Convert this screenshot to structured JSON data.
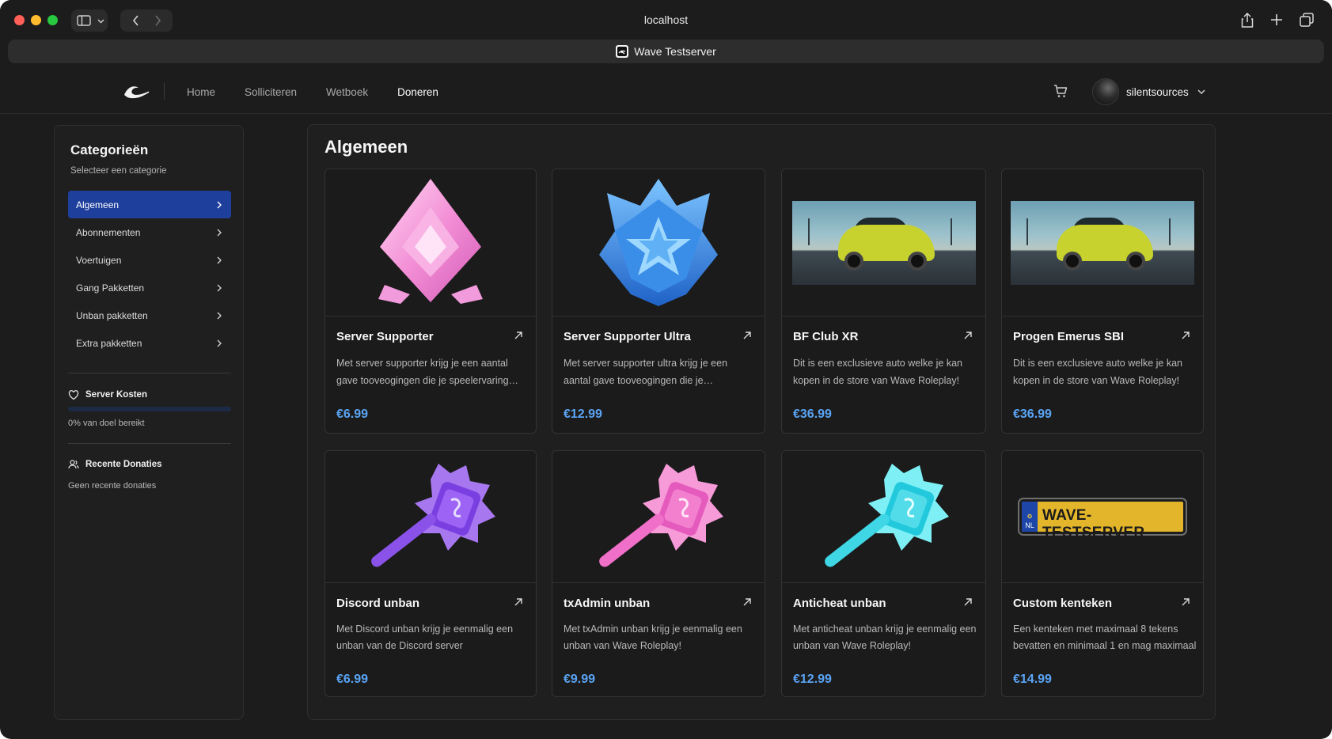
{
  "browser": {
    "url": "localhost",
    "tab_title": "Wave Testserver"
  },
  "nav": {
    "items": [
      {
        "label": "Home",
        "active": false
      },
      {
        "label": "Solliciteren",
        "active": false
      },
      {
        "label": "Wetboek",
        "active": false
      },
      {
        "label": "Doneren",
        "active": true
      }
    ],
    "username": "silentsources"
  },
  "sidebar": {
    "title": "Categorieën",
    "subtitle": "Selecteer een categorie",
    "categories": [
      {
        "label": "Algemeen",
        "active": true
      },
      {
        "label": "Abonnementen",
        "active": false
      },
      {
        "label": "Voertuigen",
        "active": false
      },
      {
        "label": "Gang Pakketten",
        "active": false
      },
      {
        "label": "Unban pakketten",
        "active": false
      },
      {
        "label": "Extra pakketten",
        "active": false
      }
    ],
    "server_kosten": {
      "title": "Server Kosten",
      "progress_percent": 0,
      "progress_text": "0% van doel bereikt"
    },
    "recent": {
      "title": "Recente Donaties",
      "empty_text": "Geen recente donaties"
    }
  },
  "main": {
    "title": "Algemeen",
    "products": [
      {
        "name": "Server Supporter",
        "description": "Met server supporter krijg je een aantal gave tooveogingen die je speelervaring verbeteren",
        "price": "€6.99",
        "image": "pink-diamond-badge"
      },
      {
        "name": "Server Supporter Ultra",
        "description": "Met server supporter ultra krijg je een aantal gave tooveogingen die je speelervaring verbeteren",
        "price": "€12.99",
        "image": "blue-star-crest"
      },
      {
        "name": "BF Club XR",
        "description": "Dit is een exclusieve auto welke je kan kopen in de store van Wave Roleplay!",
        "price": "€36.99",
        "image": "yellow-car-photo"
      },
      {
        "name": "Progen Emerus SBI",
        "description": "Dit is een exclusieve auto welke je kan kopen in de store van Wave Roleplay!",
        "price": "€36.99",
        "image": "yellow-car-photo"
      },
      {
        "name": "Discord unban",
        "description": "Met Discord unban krijg je eenmalig een unban van de Discord server",
        "price": "€6.99",
        "image": "purple-hammer"
      },
      {
        "name": "txAdmin unban",
        "description": "Met txAdmin unban krijg je eenmalig een unban van Wave Roleplay!",
        "price": "€9.99",
        "image": "pink-hammer"
      },
      {
        "name": "Anticheat unban",
        "description": "Met anticheat unban krijg je eenmalig een unban van Wave Roleplay!",
        "price": "€12.99",
        "image": "cyan-hammer"
      },
      {
        "name": "Custom kenteken",
        "description": "Een kenteken met maximaal 8 tekens bevatten en minimaal 1 en mag maximaal",
        "price": "€14.99",
        "image": "license-plate",
        "plate_country": "NL",
        "plate_text": "WAVE-TESTSERVER"
      }
    ]
  },
  "colors": {
    "accent": "#1f3f9d",
    "price": "#5aa4f5",
    "background": "#1c1c1c"
  }
}
